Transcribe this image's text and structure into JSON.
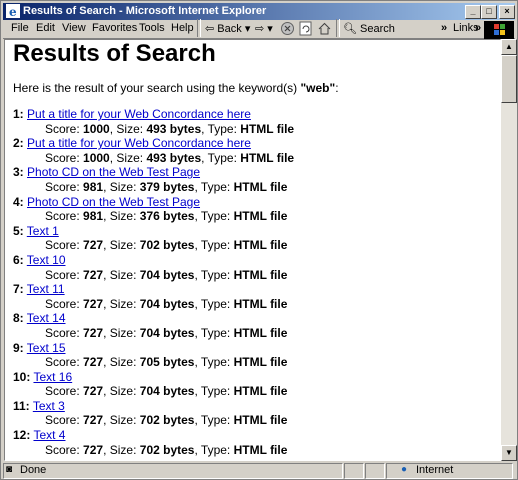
{
  "window": {
    "title": "Results of Search - Microsoft Internet Explorer",
    "controls": {
      "minimize": "_",
      "maximize": "□",
      "close": "×"
    }
  },
  "menu": [
    "File",
    "Edit",
    "View",
    "Favorites",
    "Tools",
    "Help"
  ],
  "toolbar": {
    "back_label": "Back",
    "search_label": "Search",
    "chevron": "»",
    "links_label": "Links"
  },
  "page": {
    "heading": "Results of Search",
    "intro_prefix": "Here is the result of your search using the keyword(s) ",
    "keyword": "\"web\"",
    "intro_suffix": ":",
    "score_label": "Score:",
    "size_label": ", Size:",
    "type_label": ", Type:",
    "results": [
      {
        "num": "1:",
        "title": "Put a title for your Web Concordance here",
        "score": "1000",
        "size": "493 bytes",
        "type": "HTML file"
      },
      {
        "num": "2:",
        "title": "Put a title for your Web Concordance here",
        "score": "1000",
        "size": "493 bytes",
        "type": "HTML file"
      },
      {
        "num": "3:",
        "title": "Photo CD on the Web Test Page",
        "score": "981",
        "size": "379 bytes",
        "type": "HTML file"
      },
      {
        "num": "4:",
        "title": "Photo CD on the Web Test Page",
        "score": "981",
        "size": "376 bytes",
        "type": "HTML file"
      },
      {
        "num": "5:",
        "title": "Text 1",
        "score": "727",
        "size": "702 bytes",
        "type": "HTML file"
      },
      {
        "num": "6:",
        "title": "Text 10",
        "score": "727",
        "size": "704 bytes",
        "type": "HTML file"
      },
      {
        "num": "7:",
        "title": "Text 11",
        "score": "727",
        "size": "704 bytes",
        "type": "HTML file"
      },
      {
        "num": "8:",
        "title": "Text 14",
        "score": "727",
        "size": "704 bytes",
        "type": "HTML file"
      },
      {
        "num": "9:",
        "title": "Text 15",
        "score": "727",
        "size": "705 bytes",
        "type": "HTML file"
      },
      {
        "num": "10:",
        "title": "Text 16",
        "score": "727",
        "size": "704 bytes",
        "type": "HTML file"
      },
      {
        "num": "11:",
        "title": "Text 3",
        "score": "727",
        "size": "702 bytes",
        "type": "HTML file"
      },
      {
        "num": "12:",
        "title": "Text 4",
        "score": "727",
        "size": "702 bytes",
        "type": "HTML file"
      }
    ]
  },
  "status": {
    "left": "Done",
    "zone": "Internet"
  },
  "colors": {
    "titlebar_start": "#0a246a",
    "titlebar_end": "#a6caf0",
    "link": "#0000cc",
    "chrome": "#d4d0c8"
  }
}
